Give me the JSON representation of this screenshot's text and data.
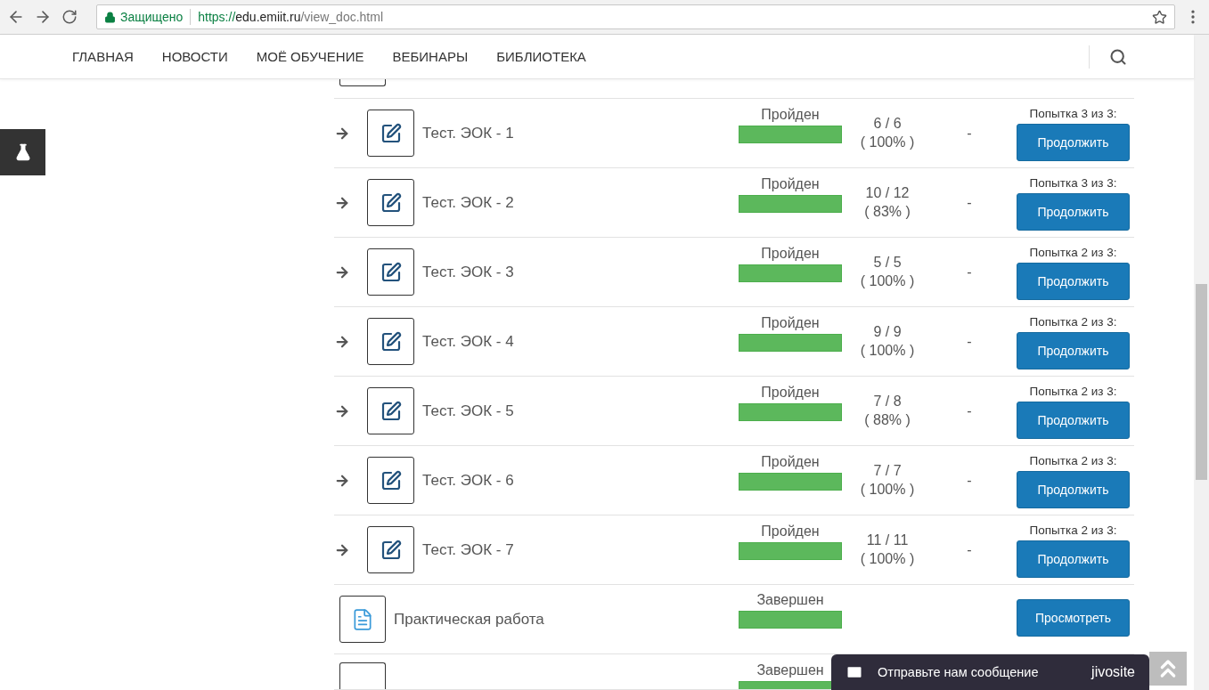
{
  "browser": {
    "security_label": "Защищено",
    "url_scheme": "https://",
    "url_host": "edu.emiit.ru",
    "url_path": "/view_doc.html"
  },
  "nav": {
    "items": [
      "ГЛАВНАЯ",
      "НОВОСТИ",
      "МОЁ ОБУЧЕНИЕ",
      "ВЕБИНАРЫ",
      "БИБЛИОТЕКА"
    ]
  },
  "rows": [
    {
      "kind": "cut"
    },
    {
      "kind": "test",
      "title": "Тест. ЭОК - 1",
      "status": "Пройден",
      "level": 1,
      "score": "6 / 6",
      "percent": "( 100% )",
      "dash": "-",
      "attempt": "Попытка 3 из 3:",
      "button": "Продолжить"
    },
    {
      "kind": "test",
      "title": "Тест. ЭОК - 2",
      "status": "Пройден",
      "level": 1,
      "score": "10 / 12",
      "percent": "( 83% )",
      "dash": "-",
      "attempt": "Попытка 3 из 3:",
      "button": "Продолжить"
    },
    {
      "kind": "test",
      "title": "Тест. ЭОК - 3",
      "status": "Пройден",
      "level": 1,
      "score": "5 / 5",
      "percent": "( 100% )",
      "dash": "-",
      "attempt": "Попытка 2 из 3:",
      "button": "Продолжить"
    },
    {
      "kind": "test",
      "title": "Тест. ЭОК - 4",
      "status": "Пройден",
      "level": 1,
      "score": "9 / 9",
      "percent": "( 100% )",
      "dash": "-",
      "attempt": "Попытка 2 из 3:",
      "button": "Продолжить"
    },
    {
      "kind": "test",
      "title": "Тест. ЭОК - 5",
      "status": "Пройден",
      "level": 1,
      "score": "7 / 8",
      "percent": "( 88% )",
      "dash": "-",
      "attempt": "Попытка 2 из 3:",
      "button": "Продолжить"
    },
    {
      "kind": "test",
      "title": "Тест. ЭОК - 6",
      "status": "Пройден",
      "level": 1,
      "score": "7 / 7",
      "percent": "( 100% )",
      "dash": "-",
      "attempt": "Попытка 2 из 3:",
      "button": "Продолжить"
    },
    {
      "kind": "test",
      "title": "Тест. ЭОК - 7",
      "status": "Пройден",
      "level": 1,
      "score": "11 / 11",
      "percent": "( 100% )",
      "dash": "-",
      "attempt": "Попытка 2 из 3:",
      "button": "Продолжить"
    },
    {
      "kind": "doc",
      "title": "Практическая работа",
      "status": "Завершен",
      "level": 1,
      "button": "Просмотреть"
    },
    {
      "kind": "doc-cut",
      "status": "Завершен",
      "level": 1
    }
  ],
  "chat": {
    "message": "Отправьте нам сообщение",
    "brand": "jivosite"
  }
}
